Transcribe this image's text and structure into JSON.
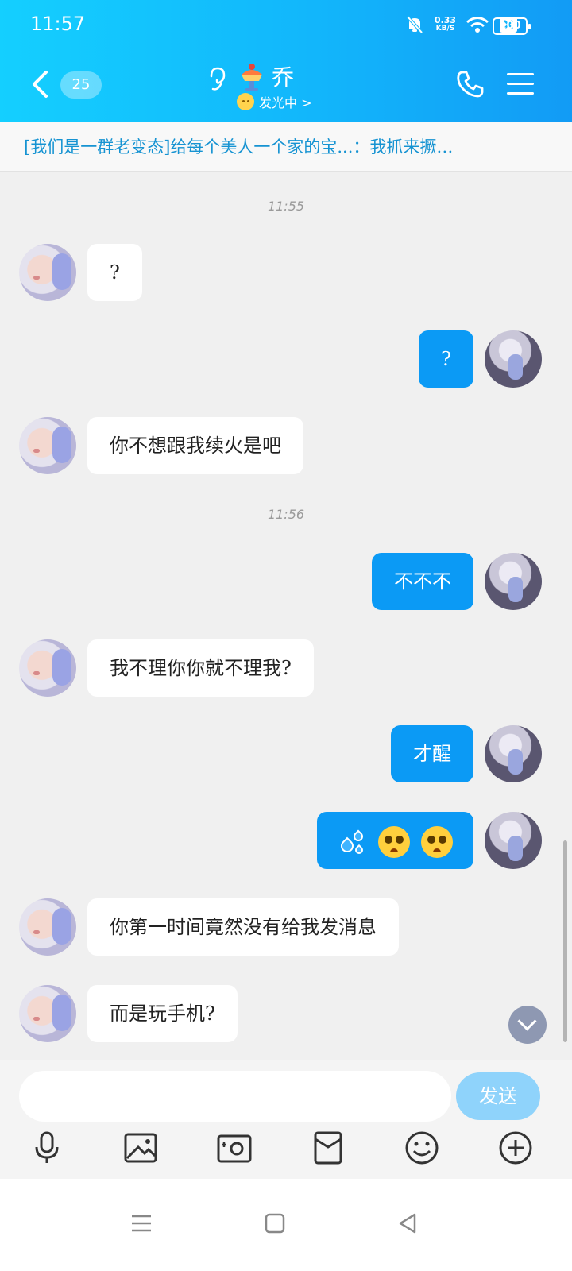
{
  "status_bar": {
    "time": "11:57",
    "net_speed_value": "0.33",
    "net_speed_unit": "KB/S",
    "battery": "100"
  },
  "header": {
    "unread_count": "25",
    "title": "乔",
    "status": "发光中 >"
  },
  "banner": {
    "text": "[我们是一群老变态]给每个美人一个家的宝...：我抓来撅…"
  },
  "messages": [
    {
      "type": "time",
      "text": "11:55"
    },
    {
      "side": "left",
      "text": "?"
    },
    {
      "side": "right",
      "text": "?"
    },
    {
      "side": "left",
      "text": "你不想跟我续火是吧"
    },
    {
      "type": "time",
      "text": "11:56"
    },
    {
      "side": "right",
      "text": "不不不"
    },
    {
      "side": "left",
      "text": "我不理你你就不理我?"
    },
    {
      "side": "right",
      "text": "才醒"
    },
    {
      "side": "right",
      "emoji": [
        "sweat-drops",
        "pleading-face",
        "pleading-face"
      ]
    },
    {
      "side": "left",
      "text": "你第一时间竟然没有给我发消息"
    },
    {
      "side": "left",
      "text": "而是玩手机?"
    }
  ],
  "input": {
    "placeholder": "",
    "send_label": "发送"
  },
  "toolbar_icons": [
    "microphone-icon",
    "image-icon",
    "camera-icon",
    "red-packet-icon",
    "emoji-icon",
    "plus-icon"
  ],
  "colors": {
    "header_gradient_start": "#14cfff",
    "header_gradient_end": "#129bf5",
    "outgoing_bubble": "#0b9af5",
    "incoming_bubble": "#ffffff",
    "banner_text": "#1693d2",
    "send_button": "#8fd3fb"
  }
}
